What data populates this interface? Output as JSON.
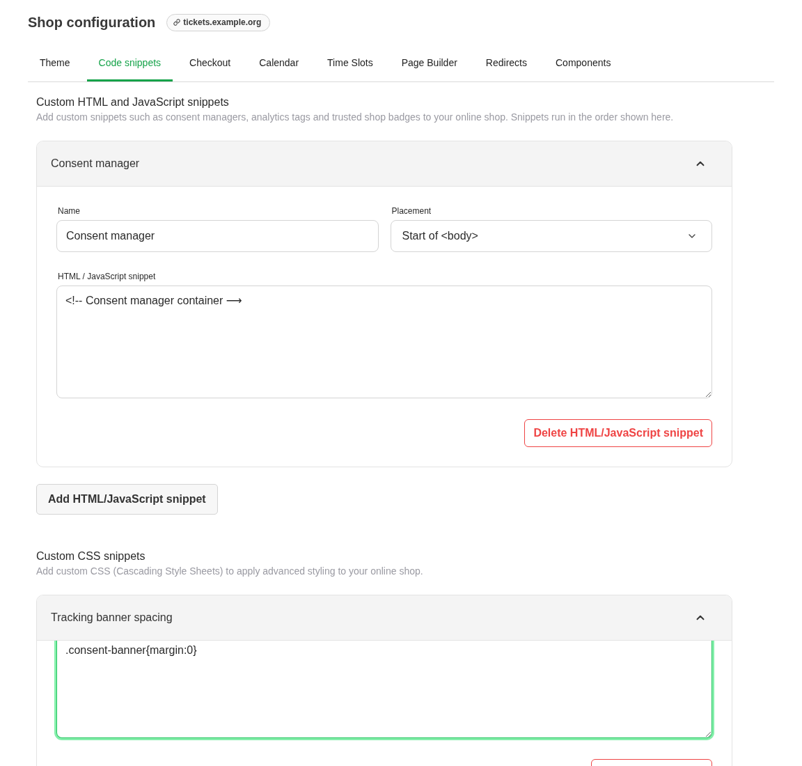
{
  "header": {
    "title": "Shop configuration",
    "domain_badge": "tickets.example.org"
  },
  "tabs": [
    {
      "label": "Theme",
      "selected": false
    },
    {
      "label": "Code snippets",
      "selected": true
    },
    {
      "label": "Checkout",
      "selected": false
    },
    {
      "label": "Calendar",
      "selected": false
    },
    {
      "label": "Time Slots",
      "selected": false
    },
    {
      "label": "Page Builder",
      "selected": false
    },
    {
      "label": "Redirects",
      "selected": false
    },
    {
      "label": "Components",
      "selected": false
    }
  ],
  "sections": [
    {
      "title": "Custom HTML and JavaScript snippets",
      "description": "Add custom snippets such as consent managers, analytics tags and trusted shop badges to your online shop. Snippets run in the order shown here.",
      "snippets": [
        {
          "title": "Consent manager",
          "expanded": true,
          "name_label": "Name",
          "name_value": "Consent manager",
          "placement_label": "Placement",
          "placement_value": "Start of <body>",
          "code_label": "HTML / JavaScript snippet",
          "code_value": "<!-- Consent manager container ⟶",
          "code_focused": false,
          "delete_label": "Delete HTML/JavaScript snippet"
        }
      ],
      "add_button": "Add HTML/JavaScript snippet"
    },
    {
      "title": "Custom CSS snippets",
      "description": "Add custom CSS (Cascading Style Sheets) to apply advanced styling to your online shop.",
      "snippets": [
        {
          "title": "Tracking banner spacing",
          "expanded": true,
          "code_value": ".consent-banner{margin:0}",
          "code_focused": true
        }
      ]
    }
  ]
}
